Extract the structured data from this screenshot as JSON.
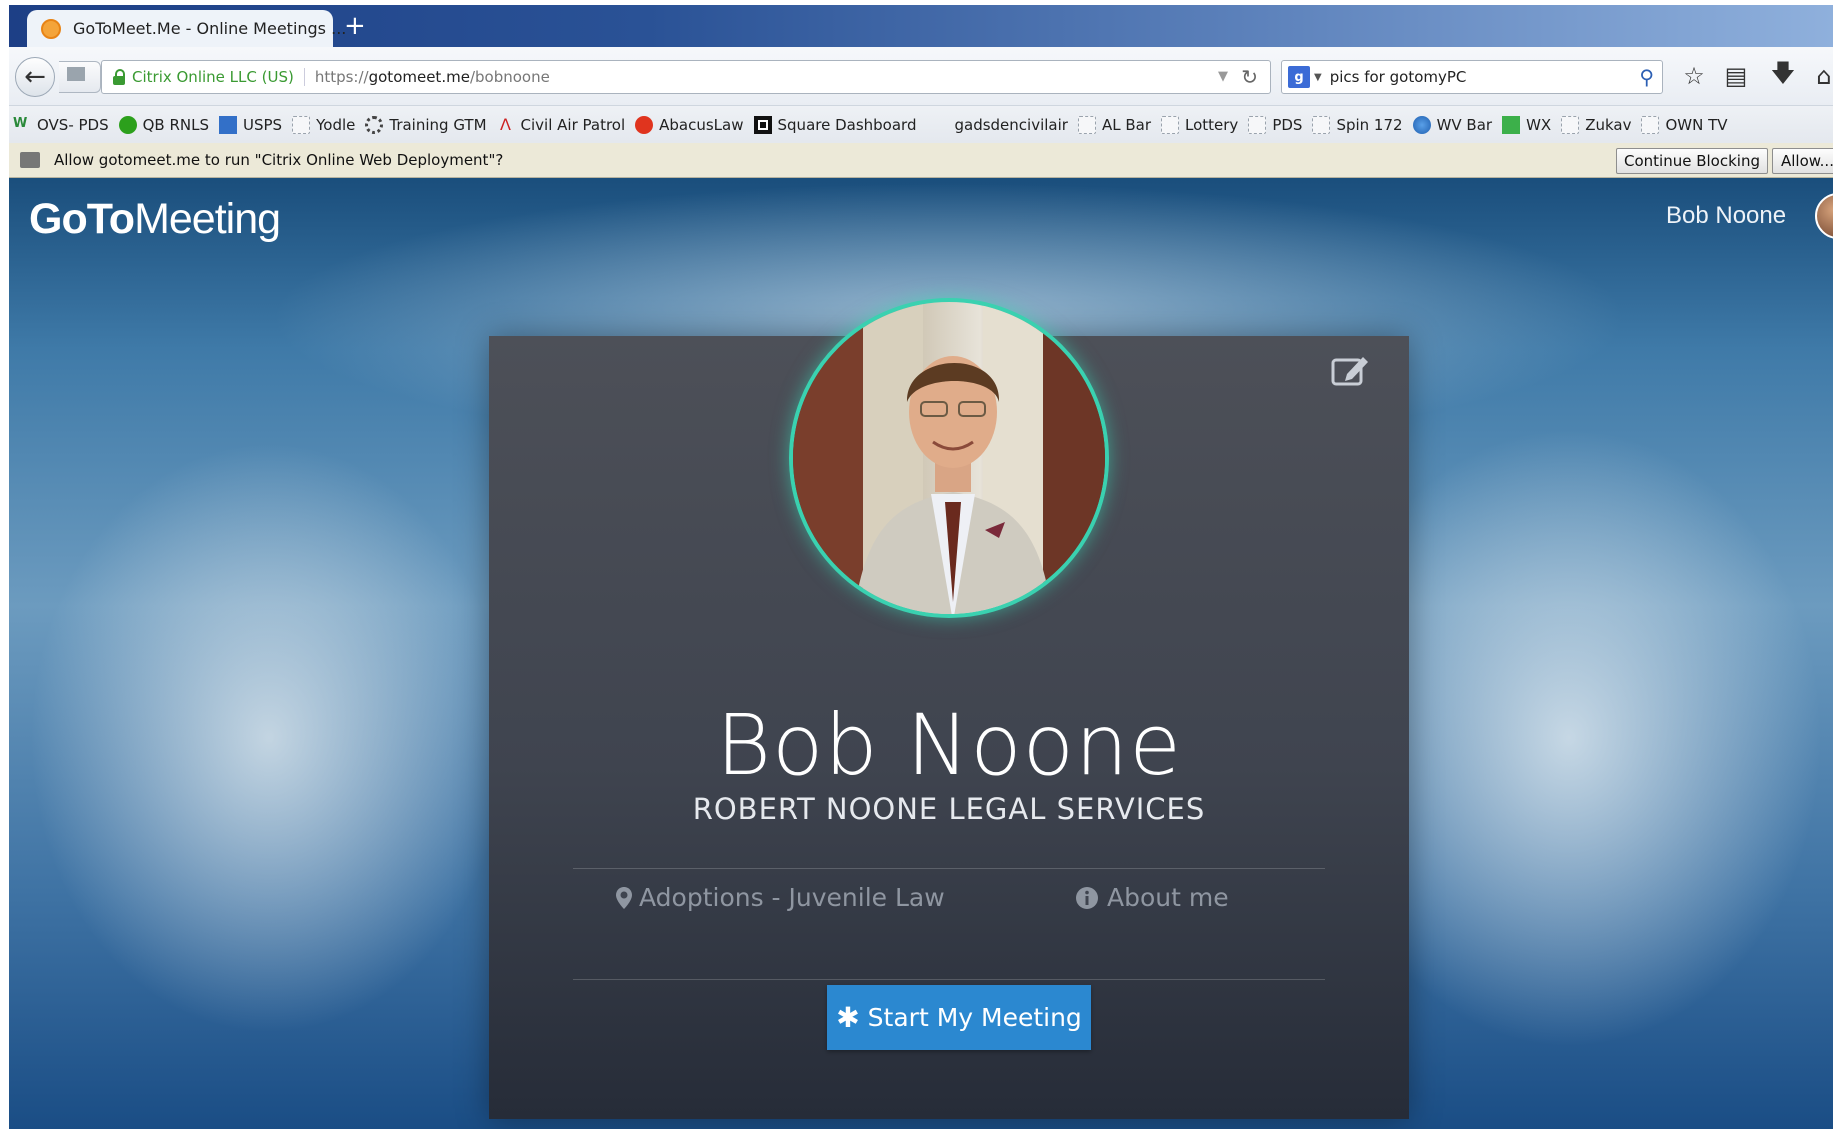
{
  "browser": {
    "tab_title": "GoToMeet.Me - Online Meetings ...",
    "new_tab_label": "+",
    "site_identity": "Citrix Online LLC (US)",
    "url_prefix": "https://",
    "url_domain": "gotomeet.me",
    "url_path": "/bobnoone",
    "search_text": "pics for gotomyPC",
    "search_engine_icon": "google-icon",
    "toolbar_icons": [
      "star-icon",
      "clipboard-icon",
      "download-icon",
      "home-icon"
    ]
  },
  "bookmarks": [
    {
      "label": "OVS- PDS",
      "icon": "wv-icon"
    },
    {
      "label": "QB RNLS",
      "icon": "qb-icon"
    },
    {
      "label": "USPS",
      "icon": "usps-icon"
    },
    {
      "label": "Yodle",
      "icon": "folder-icon"
    },
    {
      "label": "Training GTM",
      "icon": "dots-icon"
    },
    {
      "label": "Civil Air Patrol",
      "icon": "cap-icon"
    },
    {
      "label": "AbacusLaw",
      "icon": "abacus-icon"
    },
    {
      "label": "Square Dashboard",
      "icon": "square-icon"
    },
    {
      "label": "gadsdencivilair",
      "icon": ""
    },
    {
      "label": "AL Bar",
      "icon": "folder-icon"
    },
    {
      "label": "Lottery",
      "icon": "folder-icon"
    },
    {
      "label": "PDS",
      "icon": "folder-icon"
    },
    {
      "label": "Spin 172",
      "icon": "folder-icon"
    },
    {
      "label": "WV Bar",
      "icon": "globe-icon"
    },
    {
      "label": "WX",
      "icon": "wx-icon"
    },
    {
      "label": "Zukav",
      "icon": "folder-icon"
    },
    {
      "label": "OWN TV",
      "icon": "folder-icon"
    }
  ],
  "notification": {
    "message": "Allow gotomeet.me to run \"Citrix Online Web Deployment\"?",
    "continue_label": "Continue Blocking",
    "allow_label": "Allow..."
  },
  "header": {
    "logo_bold": "GoTo",
    "logo_light": "Meeting",
    "user_name": "Bob Noone"
  },
  "profile": {
    "name": "Bob Noone",
    "company": "ROBERT NOONE LEGAL SERVICES",
    "specialty": "Adoptions - Juvenile Law",
    "about_label": "About me",
    "start_button": "Start My Meeting"
  },
  "colors": {
    "accent_ring": "#3ad1b0",
    "button_blue": "#2b88d0",
    "secure_green": "#3a9a32"
  }
}
